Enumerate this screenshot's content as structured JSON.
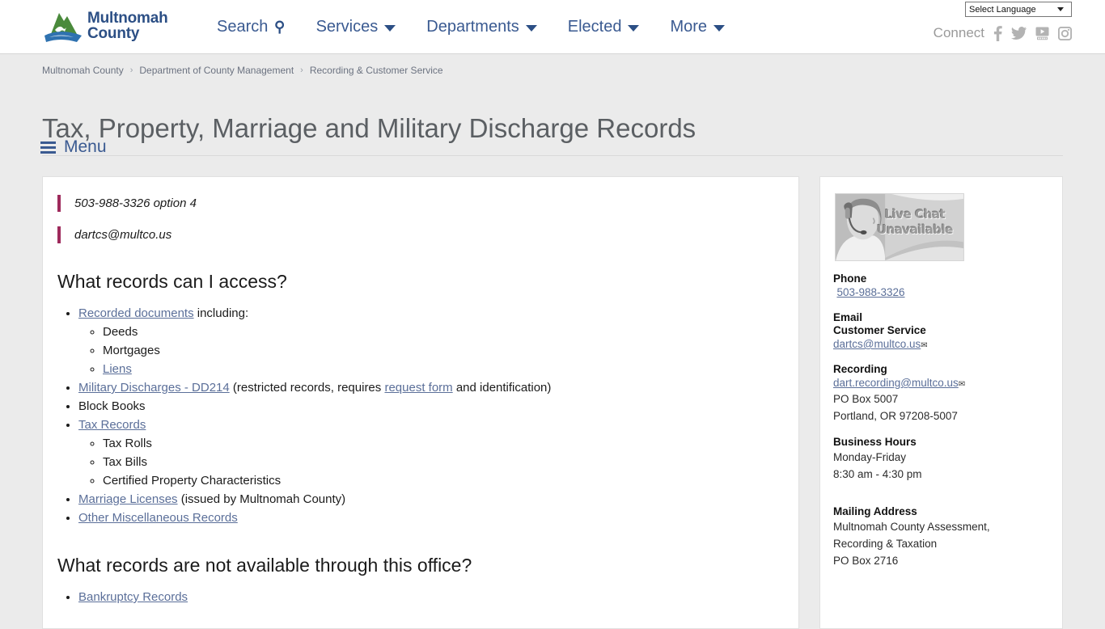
{
  "header": {
    "logo": {
      "line1": "Multnomah",
      "line2": "County",
      "icon": "multnomah-county-logo"
    },
    "nav": [
      {
        "label": "Search",
        "icon": "search-icon",
        "type": "search"
      },
      {
        "label": "Services",
        "icon": "chevron-down-icon",
        "type": "dropdown"
      },
      {
        "label": "Departments",
        "icon": "chevron-down-icon",
        "type": "dropdown"
      },
      {
        "label": "Elected",
        "icon": "chevron-down-icon",
        "type": "dropdown"
      },
      {
        "label": "More",
        "icon": "chevron-down-icon",
        "type": "dropdown"
      }
    ],
    "language_selector": {
      "value": "Select Language",
      "icon": "chevron-down-icon"
    },
    "connect": {
      "label": "Connect",
      "icons": [
        "facebook-icon",
        "twitter-icon",
        "youtube-icon",
        "instagram-icon"
      ]
    }
  },
  "breadcrumb": {
    "items": [
      "Multnomah County",
      "Department of County Management",
      "Recording & Customer Service"
    ],
    "separator": "›"
  },
  "page": {
    "title": "Tax, Property, Marriage and Military Discharge Records",
    "menu_label": "Menu"
  },
  "main": {
    "callouts": [
      "503-988-3326 option 4",
      "dartcs@multco.us"
    ],
    "section1": {
      "heading": "What records can I access?",
      "items": [
        {
          "link": "Recorded documents",
          "after": " including:",
          "children": [
            {
              "text": "Deeds",
              "is_link": false
            },
            {
              "text": "Mortgages",
              "is_link": false
            },
            {
              "text": "Liens",
              "is_link": true
            }
          ]
        },
        {
          "link": "Military Discharges - DD214",
          "after": " (restricted records, requires ",
          "link2": "request form",
          "after2": " and identification)"
        },
        {
          "text": "Block Books",
          "is_link": false
        },
        {
          "link": "Tax Records",
          "after": "",
          "children": [
            {
              "text": "Tax Rolls",
              "is_link": false
            },
            {
              "text": "Tax Bills",
              "is_link": false
            },
            {
              "text": "Certified Property Characteristics",
              "is_link": false
            }
          ]
        },
        {
          "link": "Marriage Licenses",
          "after": " (issued by Multnomah County)"
        },
        {
          "link": "Other Miscellaneous Records",
          "after": ""
        }
      ]
    },
    "section2": {
      "heading": "What records are not available through this office?",
      "first_item": "Bankruptcy Records"
    }
  },
  "sidebar": {
    "chat_image": {
      "name": "live-chat-status-image",
      "caption_line1": "Live Chat",
      "caption_line2": "Unavailable"
    },
    "phone": {
      "heading": "Phone",
      "value": "503-988-3326"
    },
    "email": {
      "heading": "Email",
      "subheading": "Customer Service",
      "value": "dartcs@multco.us"
    },
    "recording": {
      "heading": "Recording",
      "email": "dart.recording@multco.us",
      "address_line1": "PO Box 5007",
      "address_line2": "Portland, OR 97208-5007"
    },
    "hours": {
      "heading": "Business Hours",
      "days": "Monday-Friday",
      "time": "8:30 am - 4:30 pm"
    },
    "mailing": {
      "heading": "Mailing Address",
      "line1": "Multnomah County Assessment,",
      "line2": "Recording & Taxation",
      "line3": "PO Box 2716"
    }
  },
  "colors": {
    "nav_blue": "#3a5a91",
    "logo_blue": "#2c4f85",
    "logo_green": "#4a8a3c",
    "accent_maroon": "#9e2a5c",
    "link": "#5b6f99",
    "page_bg": "#ebebeb"
  }
}
